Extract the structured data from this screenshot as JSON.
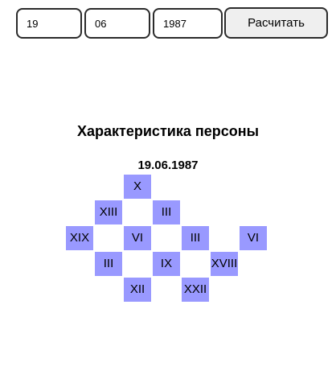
{
  "form": {
    "day": "19",
    "month": "06",
    "year": "1987",
    "calculate_label": "Расчитать"
  },
  "result": {
    "title": "Характеристика персоны",
    "date": "19.06.1987",
    "cells": {
      "row1_col3": "X",
      "row2_col2": "XIII",
      "row2_col4": "III",
      "row3_col1": "XIX",
      "row3_col3": "VI",
      "row3_col5": "III",
      "row3_col7": "VI",
      "row4_col2": "III",
      "row4_col4": "IX",
      "row4_col6": "XVIII",
      "row5_col3": "XII",
      "row5_col5": "XXII"
    }
  }
}
